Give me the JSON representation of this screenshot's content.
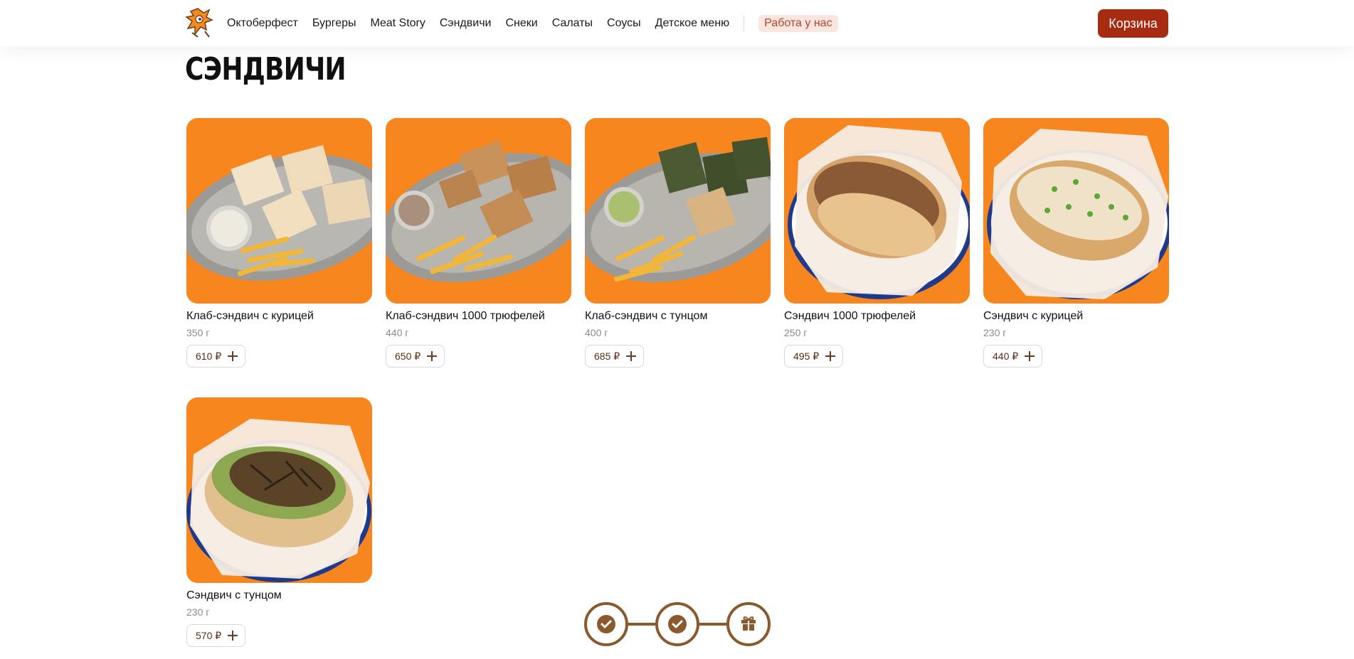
{
  "header": {
    "nav": [
      {
        "label": "Октоберфест"
      },
      {
        "label": "Бургеры"
      },
      {
        "label": "Meat Story"
      },
      {
        "label": "Сэндвичи"
      },
      {
        "label": "Снеки"
      },
      {
        "label": "Салаты"
      },
      {
        "label": "Соусы"
      },
      {
        "label": "Детское меню"
      }
    ],
    "jobs_label": "Работа у нас",
    "cart_label": "Корзина"
  },
  "section": {
    "title": "СЭНДВИЧИ"
  },
  "products": [
    {
      "name": "Клаб-сэндвич с курицей",
      "weight": "350 г",
      "price": "610 ₽"
    },
    {
      "name": "Клаб-сэндвич 1000 трюфелей",
      "weight": "440 г",
      "price": "650 ₽"
    },
    {
      "name": "Клаб-сэндвич с тунцом",
      "weight": "400 г",
      "price": "685 ₽"
    },
    {
      "name": "Сэндвич 1000 трюфелей",
      "weight": "250 г",
      "price": "495 ₽"
    },
    {
      "name": "Сэндвич с курицей",
      "weight": "230 г",
      "price": "440 ₽"
    },
    {
      "name": "Сэндвич с тунцом",
      "weight": "230 г",
      "price": "570 ₽"
    }
  ],
  "progress": {
    "steps": [
      {
        "icon": "check-icon",
        "completed": true
      },
      {
        "icon": "check-icon",
        "completed": true
      },
      {
        "icon": "gift-icon",
        "completed": false
      }
    ]
  },
  "colors": {
    "accent": "#a62b10",
    "card_background": "#f7861f",
    "progress": "#8a5a2e",
    "jobs_pill_bg": "#fbe5df"
  }
}
